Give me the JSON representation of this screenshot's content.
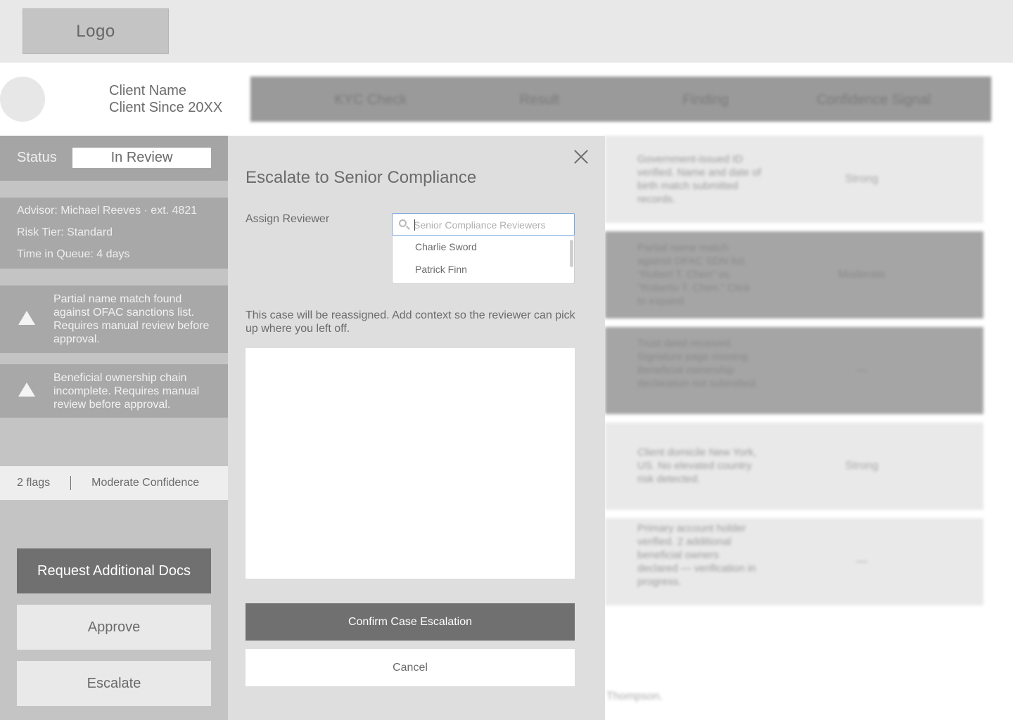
{
  "header": {
    "logo": "Logo"
  },
  "client": {
    "name": "Client Name",
    "since": "Client Since 20XX"
  },
  "table": {
    "columns": [
      "KYC Check",
      "Result",
      "Finding",
      "Confidence Signal"
    ],
    "rows": [
      {
        "finding": "Government-issued ID verified. Name and date of birth match submitted records.",
        "signal": "Strong",
        "shade": "light"
      },
      {
        "finding": "Partial name match against OFAC SDN list. \"Robert T. Chen\" vs. \"Roberto T. Chen.\" Click to expand.",
        "signal": "Moderate",
        "shade": "dark"
      },
      {
        "finding": "Trust deed received. Signature page missing. Beneficial ownership declaration not submitted.",
        "signal": "—",
        "shade": "dark"
      },
      {
        "finding": "Client domicile New York, US. No elevated country risk detected.",
        "signal": "Strong",
        "shade": "light"
      },
      {
        "finding": "Primary account holder verified. 2 additional beneficial owners declared — verification in progress.",
        "signal": "—",
        "shade": "light"
      }
    ],
    "footer_note": "Thompson."
  },
  "sidebar": {
    "status_label": "Status",
    "status_value": "In Review",
    "info": [
      "Advisor: Michael Reeves · ext. 4821",
      "Risk Tier: Standard",
      "Time in Queue: 4 days"
    ],
    "flags": [
      "Partial name match found against OFAC sanctions list. Requires manual review before approval.",
      "Beneficial ownership chain incomplete. Requires manual review before approval."
    ],
    "flag_count": "2 flags",
    "confidence": "Moderate Confidence",
    "actions": {
      "request_docs": "Request Additional Docs",
      "approve": "Approve",
      "escalate": "Escalate"
    }
  },
  "modal": {
    "title": "Escalate to Senior Compliance",
    "assign_label": "Assign Reviewer",
    "search_placeholder": "Senior Compliance Reviewers",
    "options": [
      "Charlie Sword",
      "Patrick Finn"
    ],
    "context_text": "This case will be reassigned. Add context so the reviewer can pick up where you left off.",
    "confirm": "Confirm Case Escalation",
    "cancel": "Cancel"
  },
  "colors": {
    "modal_bg": "#dedede",
    "sidebar_bg": "#c4c4c4",
    "primary_button": "#707070",
    "search_focus": "#7aa7e0"
  }
}
